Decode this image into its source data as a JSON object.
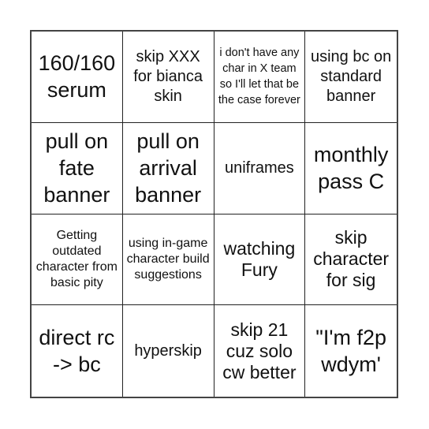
{
  "board": {
    "cells": [
      {
        "text": "160/160 serum"
      },
      {
        "text": "skip XXX for bianca skin"
      },
      {
        "text": "i don't have any char in X team so I'll let that be the case forever"
      },
      {
        "text": "using bc on standard banner"
      },
      {
        "text": "pull on fate banner"
      },
      {
        "text": "pull on arrival banner"
      },
      {
        "text": "uniframes"
      },
      {
        "text": "monthly pass C"
      },
      {
        "text": "Getting outdated character from basic pity"
      },
      {
        "text": "using in-game character build suggestions"
      },
      {
        "text": "watching Fury"
      },
      {
        "text": "skip character for sig"
      },
      {
        "text": "direct rc -> bc"
      },
      {
        "text": "hyperskip"
      },
      {
        "text": "skip 21 cuz solo cw better"
      },
      {
        "text": "\"I'm f2p wdym'"
      }
    ]
  }
}
